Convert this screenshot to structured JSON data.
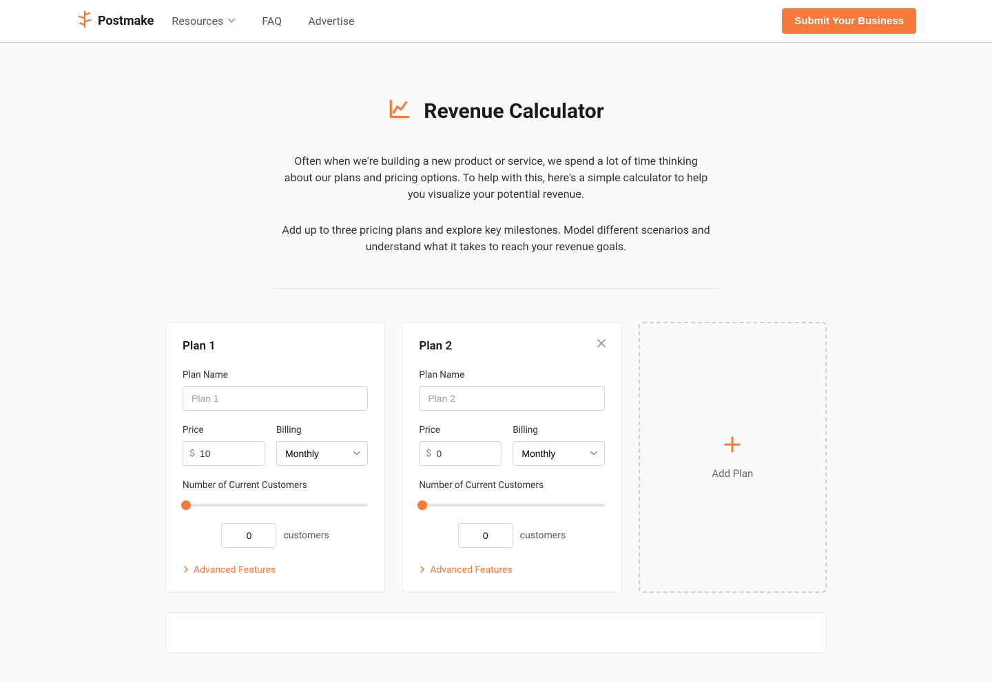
{
  "header": {
    "brand": "Postmake",
    "nav": {
      "resources": "Resources",
      "faq": "FAQ",
      "advertise": "Advertise"
    },
    "submit": "Submit Your Business"
  },
  "hero": {
    "title": "Revenue Calculator",
    "p1": "Often when we're building a new product or service, we spend a lot of time thinking about our plans and pricing options. To help with this, here's a simple calculator to help you visualize your potential revenue.",
    "p2": "Add up to three pricing plans and explore key milestones. Model different scenarios and understand what it takes to reach your revenue goals."
  },
  "labels": {
    "plan_name": "Plan Name",
    "price": "Price",
    "billing": "Billing",
    "num_customers": "Number of Current Customers",
    "customers": "customers",
    "advanced": "Advanced Features",
    "add_plan": "Add Plan",
    "currency_symbol": "$"
  },
  "plans": [
    {
      "title": "Plan 1",
      "name_placeholder": "Plan 1",
      "price": "10",
      "billing": "Monthly",
      "customers": "0",
      "closable": false
    },
    {
      "title": "Plan 2",
      "name_placeholder": "Plan 2",
      "price": "0",
      "billing": "Monthly",
      "customers": "0",
      "closable": true
    }
  ]
}
